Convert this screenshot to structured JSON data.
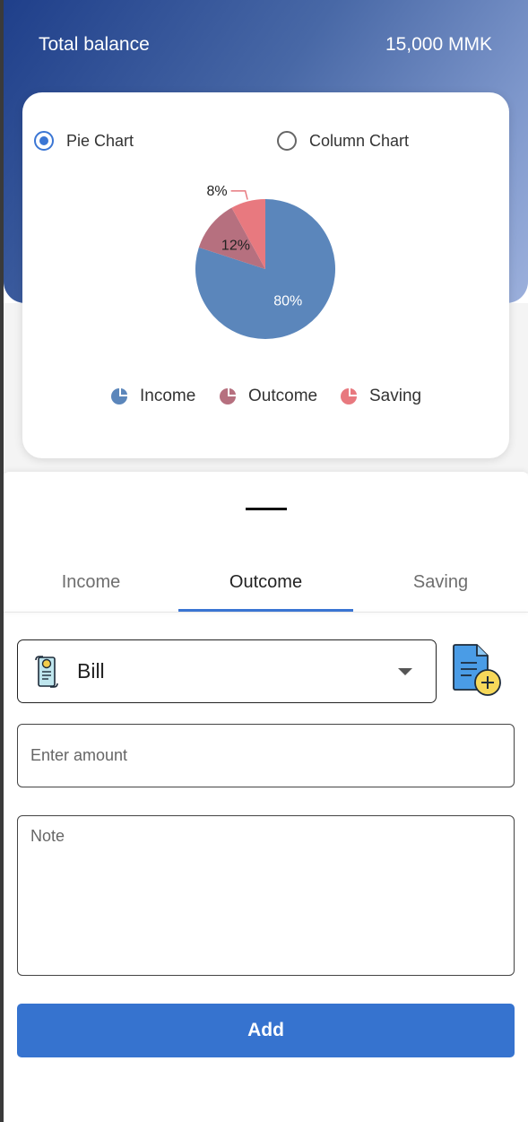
{
  "header": {
    "balance_label": "Total balance",
    "balance_value": "15,000 MMK"
  },
  "chart_toggle": {
    "options": [
      {
        "label": "Pie Chart",
        "selected": true
      },
      {
        "label": "Column Chart",
        "selected": false
      }
    ]
  },
  "chart_data": {
    "type": "pie",
    "slices": [
      {
        "name": "Income",
        "value": 80,
        "label": "80%",
        "color": "#5b86bb"
      },
      {
        "name": "Outcome",
        "value": 12,
        "label": "12%",
        "color": "#b6707f"
      },
      {
        "name": "Saving",
        "value": 8,
        "label": "8%",
        "color": "#e8797f"
      }
    ],
    "legend_position": "bottom"
  },
  "tabs": [
    {
      "label": "Income",
      "active": false
    },
    {
      "label": "Outcome",
      "active": true
    },
    {
      "label": "Saving",
      "active": false
    }
  ],
  "form": {
    "category": {
      "value": "Bill",
      "icon": "bill-receipt-icon"
    },
    "add_category_icon": "add-document-icon",
    "amount": {
      "placeholder": "Enter amount",
      "value": ""
    },
    "note": {
      "placeholder": "Note",
      "value": ""
    },
    "submit_label": "Add"
  },
  "colors": {
    "accent": "#3673cf",
    "header_gradient_start": "#1f3f8a",
    "header_gradient_end": "#9cb0dc"
  }
}
